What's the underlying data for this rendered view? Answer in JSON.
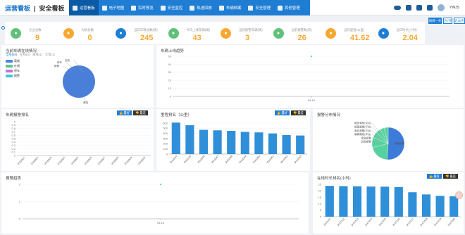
{
  "header": {
    "brand": "运营看板",
    "brand2": "安全看板"
  },
  "nav": [
    {
      "label": "运营看板",
      "active": true
    },
    {
      "label": "电子地图"
    },
    {
      "label": "实时预览"
    },
    {
      "label": "安全监控"
    },
    {
      "label": "轨迹回放"
    },
    {
      "label": "车辆档案"
    },
    {
      "label": "安全管理"
    },
    {
      "label": "其他管理"
    }
  ],
  "user": {
    "name": "YWJS"
  },
  "kpis": [
    {
      "label": "企业总数",
      "value": "9",
      "color": "#61c17a",
      "icon": "flag-icon"
    },
    {
      "label": "司机总数",
      "value": "0",
      "color": "#f7a833",
      "icon": "driver-icon"
    },
    {
      "label": "当前车辆总数(辆)",
      "value": "245",
      "color": "#1f7ed3",
      "icon": "car-icon"
    },
    {
      "label": "今日上线车辆(辆)",
      "value": "43",
      "color": "#61c17a",
      "icon": "car-online-icon"
    },
    {
      "label": "当前报警车辆(辆)",
      "value": "3",
      "color": "#f7a833",
      "icon": "lock-icon"
    },
    {
      "label": "当前报警数(次)",
      "value": "26",
      "color": "#61c17a",
      "icon": "alarm-icon"
    },
    {
      "label": "当日里程(公里)",
      "value": "41.62",
      "color": "#f7a833",
      "icon": "flag-mile-icon"
    },
    {
      "label": "当日时长(小时)",
      "value": "2.04",
      "color": "#1f7ed3",
      "icon": "clock-icon"
    }
  ],
  "range_buttons": [
    "按周一天",
    "近7天",
    "近30天"
  ],
  "panels": {
    "online": {
      "title": "当前车辆在线情况",
      "tabs": [
        "全部(89)",
        "在线(0)",
        "离线(1)",
        "大客(1)"
      ],
      "legend": [
        {
          "label": "离线",
          "color": "#4a86e8"
        },
        {
          "label": "在线",
          "color": "#58c88a"
        },
        {
          "label": "停车",
          "color": "#c76fe0"
        },
        {
          "label": "报警",
          "color": "#42c5d6"
        }
      ]
    },
    "trend": {
      "title": "车辆上线趋势"
    },
    "alarm_rank": {
      "title": "车辆报警排名",
      "good": "最好",
      "bad": "最差"
    },
    "mile_rank": {
      "title": "里程排名（公里）",
      "good": "最好",
      "bad": "最差"
    },
    "alarm_dist": {
      "title": "报警分布情况"
    },
    "alarm_trend": {
      "title": "报警趋势"
    },
    "duration_rank": {
      "title": "在线时长排名(小时)",
      "good": "最好",
      "bad": "最差"
    }
  },
  "chart_data": [
    {
      "type": "pie",
      "title": "当前车辆在线情况",
      "categories": [
        "离线",
        "在线",
        "停车",
        "报警"
      ],
      "values": [
        100,
        0,
        0,
        0
      ],
      "labels": [
        "离线",
        "在线",
        "停车",
        "报警"
      ]
    },
    {
      "type": "line",
      "title": "车辆上线趋势",
      "x": [
        "04-16"
      ],
      "values": [
        43
      ],
      "ylim": [
        0,
        50
      ],
      "yticks": [
        0,
        10,
        20,
        30,
        40,
        50
      ]
    },
    {
      "type": "bar",
      "title": "车辆报警排名",
      "categories": [
        "沪A8321",
        "沪A8322",
        "沪A8323",
        "沪A8324",
        "沪A8325",
        "沪A8326",
        "沪A8327",
        "沪A8328",
        "沪A8329",
        "沪A8330"
      ],
      "values": [
        0,
        0,
        0,
        0,
        0,
        0,
        0,
        0,
        0,
        0
      ],
      "ylim": [
        0,
        1
      ],
      "yticks": [
        0,
        0.1,
        0.2,
        0.3,
        0.4,
        0.5,
        0.6,
        0.7,
        0.8,
        0.9,
        1
      ]
    },
    {
      "type": "bar",
      "title": "里程排名（公里）",
      "categories": [
        "沪A3344",
        "沪A3345",
        "沪A3346",
        "沪A3347",
        "沪A3348",
        "沪A3349",
        "沪A3350",
        "沪A3351",
        "沪A3352",
        "沪A3353"
      ],
      "values": [
        610,
        560,
        470,
        460,
        450,
        430,
        420,
        400,
        370,
        360
      ],
      "ylim": [
        0,
        600
      ],
      "yticks": [
        0,
        100,
        200,
        300,
        400,
        500,
        600
      ]
    },
    {
      "type": "pie",
      "title": "报警分布情况",
      "categories": [
        "超速报警",
        "疲劳驾驶(平台)",
        "超速报警(平台)",
        "离线报警(平台)",
        "偏离路线(平台)",
        "紧急报警",
        "其他报警"
      ],
      "values": [
        51,
        20,
        10,
        6,
        5,
        4,
        4
      ]
    },
    {
      "type": "line",
      "title": "报警趋势",
      "x": [
        "04-16"
      ],
      "values": [
        3
      ],
      "ylim": [
        0,
        2
      ],
      "yticks": [
        0,
        1,
        2
      ]
    },
    {
      "type": "bar",
      "title": "在线时长排名(小时)",
      "categories": [
        "沪A7411",
        "沪A7412",
        "沪A7413",
        "沪A7414",
        "沪A7415",
        "沪A7416",
        "沪A7417",
        "沪A7418",
        "沪A7419",
        "沪A7420"
      ],
      "values": [
        23.8,
        23.6,
        23.5,
        23.3,
        23.2,
        22.9,
        18.9,
        17.2,
        16.1,
        15.8
      ],
      "ylim": [
        0,
        25
      ],
      "yticks": [
        0,
        5,
        10,
        15,
        20,
        25
      ]
    }
  ]
}
